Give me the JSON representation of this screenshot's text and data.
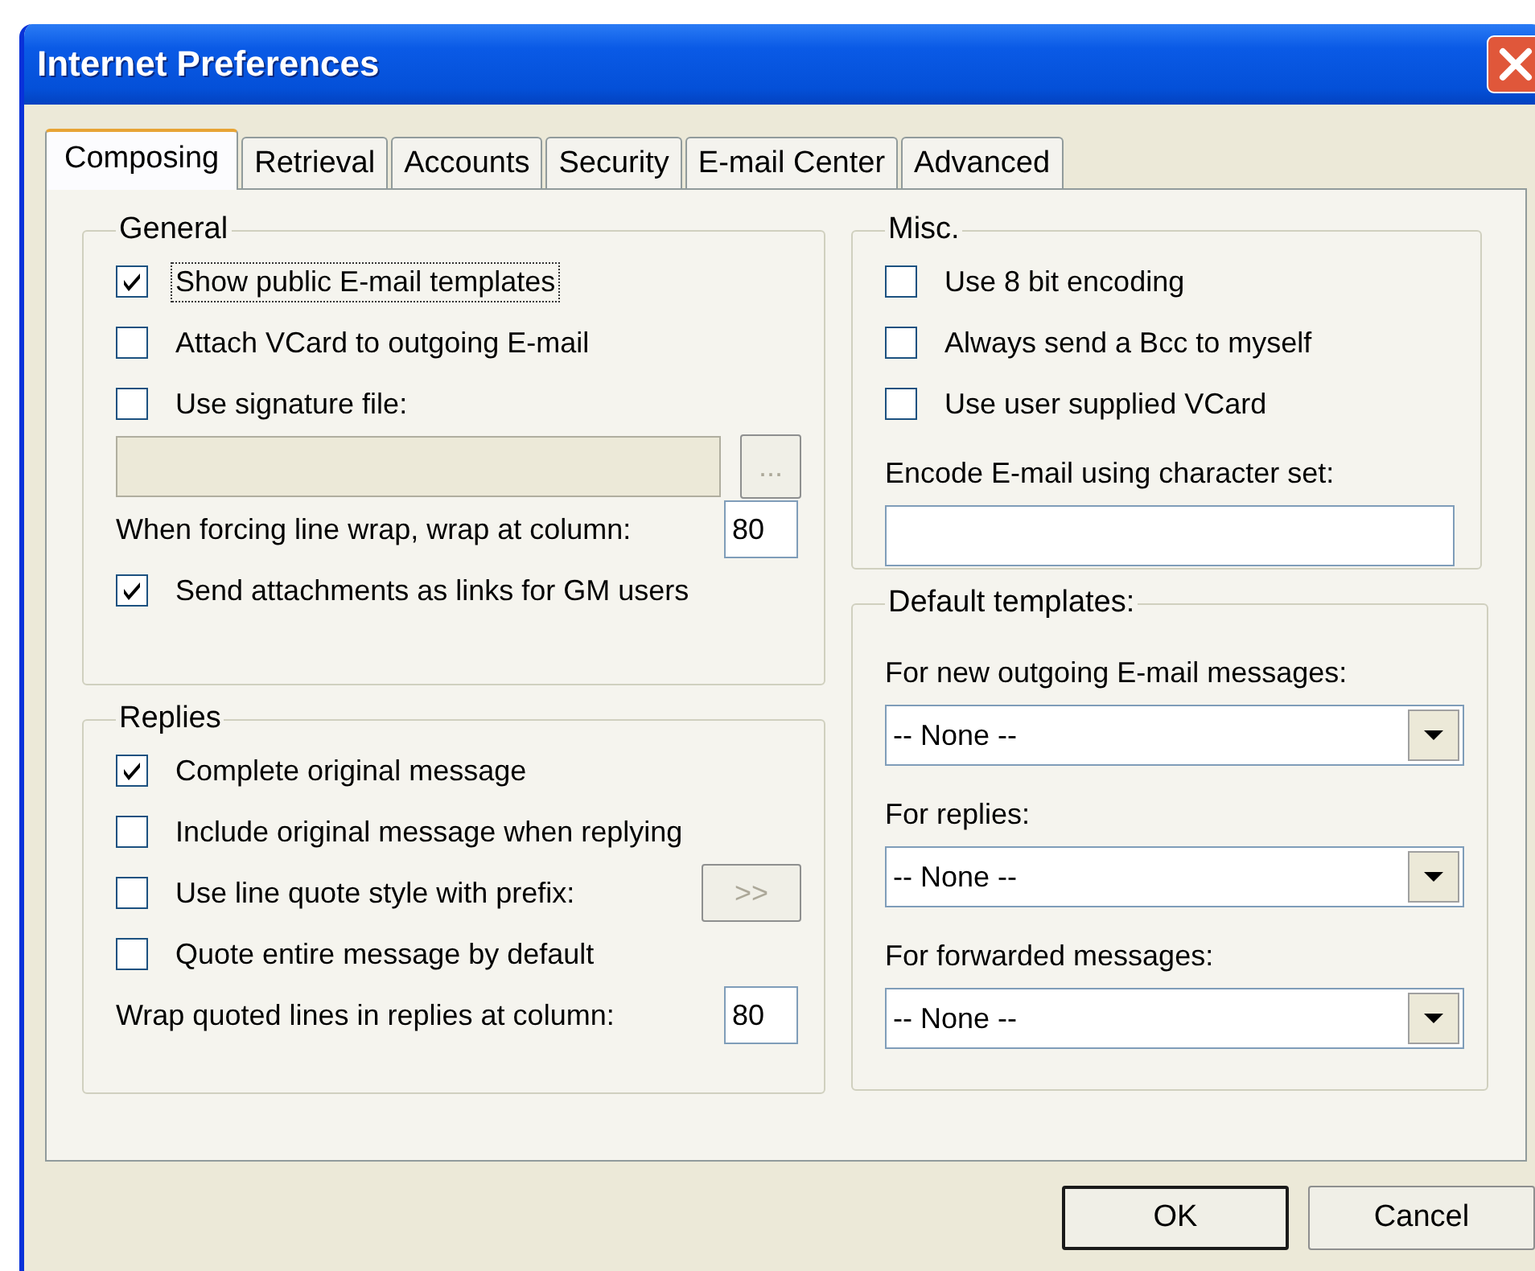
{
  "window": {
    "title": "Internet Preferences"
  },
  "tabs": [
    {
      "label": "Composing",
      "selected": true
    },
    {
      "label": "Retrieval",
      "selected": false
    },
    {
      "label": "Accounts",
      "selected": false
    },
    {
      "label": "Security",
      "selected": false
    },
    {
      "label": "E-mail Center",
      "selected": false
    },
    {
      "label": "Advanced",
      "selected": false
    }
  ],
  "columns": [
    [
      {
        "title": "General",
        "rows": [
          {
            "kind": "checkbox",
            "label": "Show public E-mail templates",
            "checked": true,
            "focused": true
          },
          {
            "kind": "checkbox",
            "label": "Attach VCard to outgoing E-mail",
            "checked": false,
            "focused": false
          },
          {
            "kind": "checkbox",
            "label": "Use signature file:",
            "checked": false,
            "focused": false
          },
          {
            "kind": "file",
            "button": "...",
            "disabled": true
          },
          {
            "kind": "number",
            "label": "When forcing line wrap, wrap at column:",
            "value": "80"
          },
          {
            "kind": "checkbox",
            "label": "Send attachments as links for GM users",
            "checked": true,
            "focused": false
          }
        ]
      },
      {
        "title": "Replies",
        "rows": [
          {
            "kind": "checkbox",
            "label": "Complete original message",
            "checked": true,
            "focused": false
          },
          {
            "kind": "checkbox",
            "label": "Include original message when replying",
            "checked": false,
            "focused": false
          },
          {
            "kind": "checkbox_button",
            "label": "Use line quote style with prefix:",
            "checked": false,
            "focused": false,
            "button": ">>",
            "disabled": true
          },
          {
            "kind": "checkbox",
            "label": "Quote entire message by default",
            "checked": false,
            "focused": false
          },
          {
            "kind": "number",
            "label": "Wrap quoted lines in replies at column:",
            "value": "80"
          }
        ]
      }
    ],
    [
      {
        "title": "Misc.",
        "rows": [
          {
            "kind": "checkbox",
            "label": "Use 8 bit encoding",
            "checked": false,
            "focused": false
          },
          {
            "kind": "checkbox",
            "label": "Always send a Bcc to myself",
            "checked": false,
            "focused": false
          },
          {
            "kind": "checkbox",
            "label": "Use user supplied VCard",
            "checked": false,
            "focused": false
          },
          {
            "kind": "label",
            "label": "Encode E-mail using character set:"
          },
          {
            "kind": "text"
          }
        ]
      },
      {
        "title": "Default templates:",
        "rows": [
          {
            "kind": "label",
            "label": "For new outgoing E-mail messages:"
          },
          {
            "kind": "dropdown",
            "value": "-- None --"
          },
          {
            "kind": "label",
            "label": "For replies:"
          },
          {
            "kind": "dropdown",
            "value": "-- None --"
          },
          {
            "kind": "label",
            "label": "For forwarded messages:"
          },
          {
            "kind": "dropdown",
            "value": "-- None --"
          }
        ]
      }
    ]
  ],
  "buttons": [
    {
      "label": "OK",
      "default": true
    },
    {
      "label": "Cancel",
      "default": false
    }
  ]
}
